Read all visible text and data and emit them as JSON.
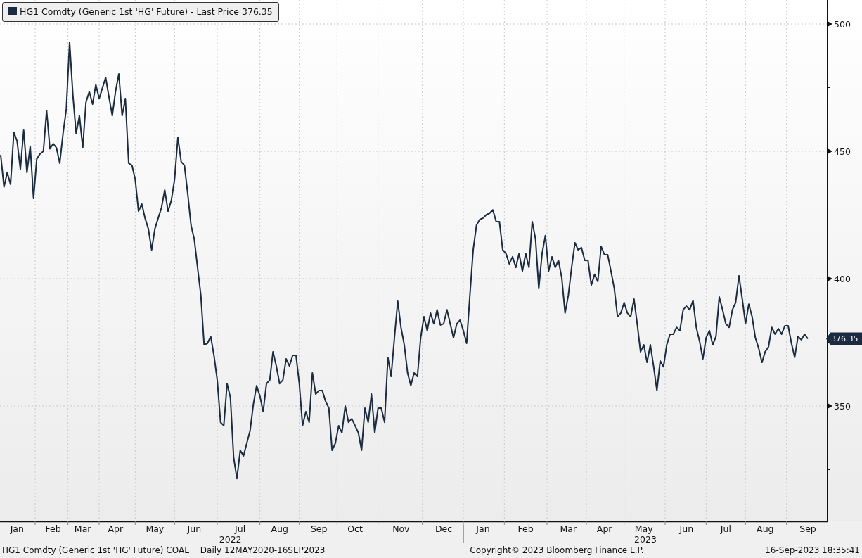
{
  "chart": {
    "last_price_tag": "376.35",
    "years": [
      "2022",
      "2023"
    ],
    "chart_data": {
      "type": "line",
      "grid": true,
      "ylim": [
        304.7,
        509.4
      ],
      "yticks": [
        350,
        400,
        450,
        500
      ],
      "categories": [
        null,
        null,
        null,
        null,
        null,
        "Jan",
        null,
        null,
        null,
        null,
        null,
        null,
        null,
        null,
        null,
        null,
        "Feb",
        null,
        null,
        null,
        null,
        null,
        null,
        null,
        null,
        "Mar",
        null,
        null,
        null,
        null,
        null,
        null,
        null,
        null,
        null,
        "Apr",
        null,
        null,
        null,
        null,
        null,
        null,
        null,
        null,
        null,
        null,
        null,
        "May",
        null,
        null,
        null,
        null,
        null,
        null,
        null,
        null,
        null,
        null,
        null,
        "Jun",
        null,
        null,
        null,
        null,
        null,
        null,
        null,
        null,
        null,
        null,
        null,
        null,
        null,
        "Jul",
        null,
        null,
        null,
        null,
        null,
        null,
        null,
        null,
        null,
        null,
        null,
        "Aug",
        null,
        null,
        null,
        null,
        null,
        null,
        null,
        null,
        null,
        null,
        null,
        "Sep",
        null,
        null,
        null,
        null,
        null,
        null,
        null,
        null,
        null,
        null,
        "Oct",
        null,
        null,
        null,
        null,
        null,
        null,
        null,
        null,
        null,
        null,
        null,
        null,
        null,
        "Nov",
        null,
        null,
        null,
        null,
        null,
        null,
        null,
        null,
        null,
        null,
        null,
        null,
        "Dec",
        null,
        null,
        null,
        null,
        null,
        null,
        null,
        null,
        null,
        null,
        null,
        "Jan",
        null,
        null,
        null,
        null,
        null,
        null,
        null,
        null,
        null,
        null,
        null,
        null,
        "Feb",
        null,
        null,
        null,
        null,
        null,
        null,
        null,
        null,
        null,
        null,
        null,
        null,
        "Mar",
        null,
        null,
        null,
        null,
        null,
        null,
        null,
        null,
        null,
        null,
        "Apr",
        null,
        null,
        null,
        null,
        null,
        null,
        null,
        null,
        null,
        null,
        null,
        "May",
        null,
        null,
        null,
        null,
        null,
        null,
        null,
        null,
        null,
        null,
        null,
        null,
        "Jun",
        null,
        null,
        null,
        null,
        null,
        null,
        null,
        null,
        null,
        null,
        null,
        "Jul",
        null,
        null,
        null,
        null,
        null,
        null,
        null,
        null,
        null,
        null,
        null,
        "Aug",
        null,
        null,
        null,
        null,
        null,
        null,
        null,
        null,
        null,
        null,
        null,
        null,
        "Sep"
      ],
      "series": [
        {
          "name": "HG1 Comdty (Generic 1st 'HG' Future) - Last Price 376.35",
          "color": "#1b2b40",
          "values": [
            448.6,
            436,
            441.7,
            437,
            457.5,
            454,
            443,
            458.3,
            441.7,
            452,
            431.5,
            447,
            449,
            450,
            466,
            451,
            453,
            451.4,
            445.3,
            457,
            466.6,
            492.8,
            472,
            457,
            464,
            451.4,
            469.3,
            473.5,
            468.5,
            476.2,
            470.7,
            474.9,
            479,
            471.3,
            464,
            473.5,
            480.4,
            464,
            470.7,
            445.3,
            444.5,
            439,
            426.5,
            429.3,
            423.8,
            419.6,
            411.3,
            419.6,
            423.8,
            427.9,
            434.8,
            426.5,
            430.7,
            439,
            455.5,
            445.9,
            444.5,
            433.4,
            421,
            415.5,
            404.4,
            393.4,
            374,
            374.6,
            377.3,
            369.9,
            360.2,
            343.6,
            342.3,
            358.8,
            353.3,
            329.8,
            321.5,
            332.6,
            330.4,
            335.4,
            340.3,
            350.6,
            358,
            353.9,
            347.8,
            358.8,
            360.2,
            371.3,
            365.7,
            358.8,
            360.2,
            368.5,
            365.7,
            369.9,
            369.9,
            358.8,
            342.3,
            347.8,
            343.6,
            363,
            354.7,
            356.1,
            356.1,
            351.9,
            349.2,
            332.6,
            335.4,
            342.3,
            339.5,
            350,
            343.6,
            345,
            342.3,
            339.5,
            332.6,
            349.2,
            343.6,
            354.7,
            339.5,
            349.2,
            349.2,
            343.6,
            369.1,
            361.6,
            376.8,
            391.2,
            380.9,
            374,
            363,
            358,
            363,
            361.6,
            376.8,
            385.1,
            379.6,
            386.5,
            382.3,
            387.8,
            381.8,
            382.3,
            387.8,
            382.3,
            376.8,
            382.3,
            383.7,
            379.6,
            374.6,
            393.4,
            411.3,
            421,
            423.2,
            423.8,
            425.1,
            425.7,
            427,
            422.4,
            422.4,
            411.3,
            409.9,
            405.8,
            408.6,
            404.4,
            409.9,
            403,
            409.9,
            404.4,
            422.4,
            415.5,
            396.1,
            409.9,
            416.9,
            403,
            408.6,
            404.4,
            407.2,
            400.3,
            386.5,
            393.4,
            404.4,
            414.1,
            411.3,
            412.2,
            407.2,
            407.2,
            397.5,
            401.7,
            398.9,
            412.7,
            409.4,
            409.4,
            403,
            396.1,
            385.1,
            386.5,
            390.6,
            386.5,
            385.1,
            392,
            382.3,
            371.3,
            374,
            367.1,
            374,
            365.4,
            356.1,
            367.7,
            365.4,
            374,
            378.2,
            378.2,
            380.9,
            379.6,
            387.8,
            389.2,
            387.8,
            391.4,
            380.9,
            375.4,
            368.5,
            376.8,
            379.6,
            374,
            377.3,
            392.8,
            387.8,
            382.3,
            380.9,
            387.8,
            390.6,
            401.1,
            392,
            382.3,
            390,
            385.1,
            376.8,
            372.7,
            367.1,
            371.3,
            373.2,
            380.9,
            378.2,
            380.4,
            378.2,
            381.5,
            381.5,
            374.6,
            369.1,
            377.3,
            376,
            378.2,
            376.4
          ]
        }
      ]
    }
  },
  "footer": {
    "security": "HG1 Comdty (Generic 1st 'HG' Future) COAL",
    "period": "Daily 12MAY2020-16SEP2023",
    "copyright": "Copyright© 2023 Bloomberg Finance L.P.",
    "timestamp": "16-Sep-2023 18:35:41"
  }
}
